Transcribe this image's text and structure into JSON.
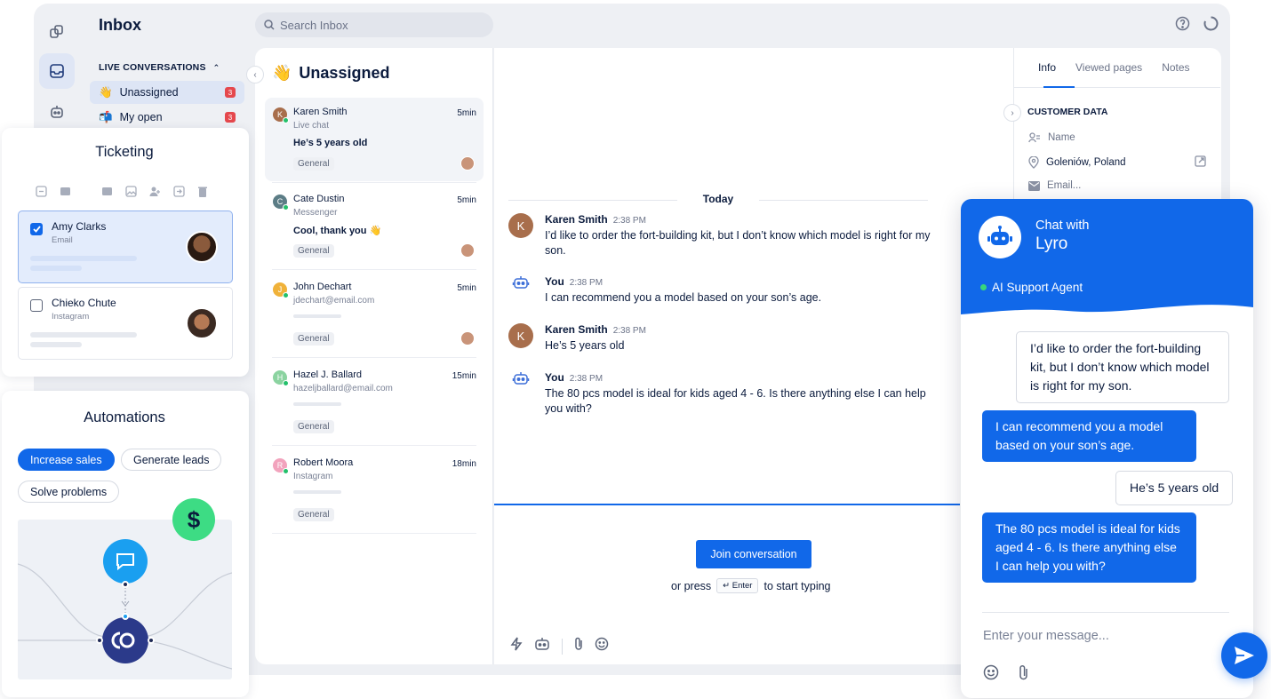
{
  "inbox": {
    "title": "Inbox",
    "search_placeholder": "Search Inbox",
    "section_label": "LIVE CONVERSATIONS",
    "nav": [
      {
        "label": "Unassigned",
        "count": "3",
        "emoji": "👋"
      },
      {
        "label": "My open",
        "count": "3",
        "emoji": "📬"
      }
    ]
  },
  "list": {
    "title": "Unassigned",
    "title_emoji": "👋",
    "conversations": [
      {
        "initial": "K",
        "name": "Karen Smith",
        "channel": "Live chat",
        "message": "He’s 5 years old",
        "time": "5min",
        "tag": "General",
        "color": "#a86e4c"
      },
      {
        "initial": "C",
        "name": "Cate Dustin",
        "channel": "Messenger",
        "message": "Cool, thank you 👋",
        "time": "5min",
        "tag": "General",
        "color": "#5c7d86"
      },
      {
        "initial": "J",
        "name": "John Dechart",
        "channel": "jdechart@email.com",
        "message": "",
        "time": "5min",
        "tag": "General",
        "color": "#f0b23a"
      },
      {
        "initial": "H",
        "name": "Hazel J. Ballard",
        "channel": "hazeljballard@email.com",
        "message": "",
        "time": "15min",
        "tag": "General",
        "color": "#8bd3a0"
      },
      {
        "initial": "R",
        "name": "Robert Moora",
        "channel": "Instagram",
        "message": "",
        "time": "18min",
        "tag": "General",
        "color": "#f2a3bd"
      }
    ]
  },
  "chat": {
    "date_label": "Today",
    "messages": [
      {
        "who": "Karen Smith",
        "time": "2:38 PM",
        "text": "I’d like to order the fort-building kit, but I don’t know which model is right for my son.",
        "kind": "customer",
        "initial": "K"
      },
      {
        "who": "You",
        "time": "2:38 PM",
        "text": "I can recommend you a model based on your son’s age.",
        "kind": "bot"
      },
      {
        "who": "Karen Smith",
        "time": "2:38 PM",
        "text": "He’s 5 years old",
        "kind": "customer",
        "initial": "K"
      },
      {
        "who": "You",
        "time": "2:38 PM",
        "text": "The 80 pcs model is ideal for kids aged 4 - 6. Is there anything else I can help you with?",
        "kind": "bot"
      }
    ],
    "join_label": "Join conversation",
    "or_press": "or press",
    "enter_key": "↵ Enter",
    "to_start": "to start typing"
  },
  "info": {
    "tabs": [
      "Info",
      "Viewed pages",
      "Notes"
    ],
    "section": "CUSTOMER DATA",
    "name_label": "Name",
    "location": "Goleniów, Poland",
    "email_label": "Email..."
  },
  "ticketing": {
    "title": "Ticketing",
    "items": [
      {
        "name": "Amy Clarks",
        "channel": "Email",
        "checked": true
      },
      {
        "name": "Chieko Chute",
        "channel": "Instagram",
        "checked": false
      }
    ]
  },
  "automations": {
    "title": "Automations",
    "chips": [
      "Increase sales",
      "Generate leads",
      "Solve problems"
    ]
  },
  "lyro": {
    "line1": "Chat with",
    "line2": "Lyro",
    "agent": "AI Support Agent",
    "bubbles": [
      {
        "text": "I’d like to order the fort-building kit, but I don’t know which model is right for my son.",
        "from": "user"
      },
      {
        "text": "I can recommend you a model based on your son’s age.",
        "from": "bot"
      },
      {
        "text": "He’s 5 years old",
        "from": "user"
      },
      {
        "text": "The 80 pcs model is ideal for kids aged 4 - 6. Is there anything else I can help you with?",
        "from": "bot"
      }
    ],
    "input_placeholder": "Enter your message..."
  },
  "colors": {
    "accent": "#1168e9",
    "badge": "#e5484d",
    "online": "#23c06b"
  }
}
